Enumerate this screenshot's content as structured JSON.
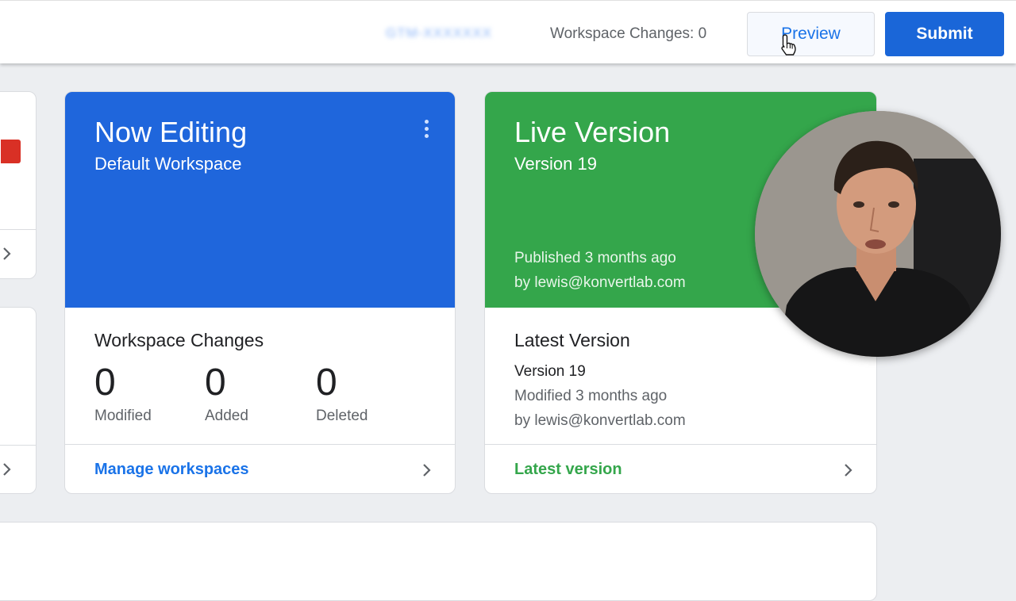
{
  "topbar": {
    "container_id": "GTM-XXXXXXX",
    "workspace_changes_text": "Workspace Changes: 0",
    "preview_label": "Preview",
    "submit_label": "Submit"
  },
  "now_editing": {
    "title": "Now Editing",
    "workspace": "Default Workspace",
    "changes_title": "Workspace Changes",
    "stats": [
      {
        "value": "0",
        "label": "Modified"
      },
      {
        "value": "0",
        "label": "Added"
      },
      {
        "value": "0",
        "label": "Deleted"
      }
    ],
    "footer_link": "Manage workspaces"
  },
  "live_version": {
    "title": "Live Version",
    "version": "Version 19",
    "published": "Published 3 months ago",
    "published_by": "by lewis@konvertlab.com",
    "latest_title": "Latest Version",
    "latest_version": "Version 19",
    "latest_modified": "Modified 3 months ago",
    "latest_by": "by lewis@konvertlab.com",
    "footer_link": "Latest version"
  },
  "colors": {
    "blue_header": "#1f66dc",
    "green_header": "#34a64b",
    "link_blue": "#1a73e8",
    "link_green": "#34a64b"
  },
  "icons": [
    "pointer-cursor-icon",
    "kebab-menu-icon",
    "chevron-right-icon"
  ]
}
